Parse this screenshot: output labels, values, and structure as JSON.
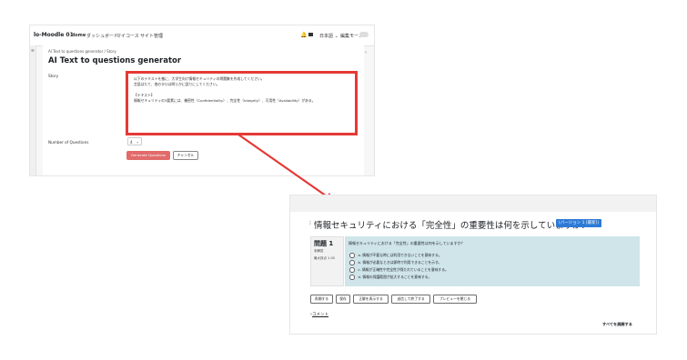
{
  "colors": {
    "highlight": "#e53935",
    "primary_button": "#e26a6a",
    "version_badge": "#2d7ad6",
    "question_panel": "#cfe5ea"
  },
  "screen1": {
    "brand": "lo-Moodle 01",
    "nav_items": [
      "Home",
      "ダッシュボード",
      "マイコース",
      "サイト管理"
    ],
    "lang": "日本語 ⌄",
    "edit_mode": "編集モード",
    "breadcrumb": "AI Text to questions generator  /  Story",
    "title": "AI Text to questions generator",
    "story_label": "Story",
    "story_lines": [
      "以下のテキストを基に、大学生向け情報セキュリティの問題集を作成してください。",
      "言語はたて、他のタロは明らかに誤りにしてください。",
      "",
      "【テキスト】",
      "情報セキュリティの3要素には、機密性（Confidentiality）、完全性（Integrity）、可用性（Availability）がある。"
    ],
    "num_questions_label": "Number of Questions",
    "num_questions_value": "4",
    "generate_button": "Generate Questions",
    "cancel_button": "キャンセル"
  },
  "screen2": {
    "question_title": "情報セキュリティにおける「完全性」の重要性は何を示していますか？",
    "version_badge": "(バージョン 1 [最新])",
    "question_label": "問題 1",
    "state": "未解答",
    "mark": "最大評点 1.00",
    "question_text": "情報セキュリティにおける「完全性」の重要性は何を示していますか？",
    "options": [
      "a.  情報が不要な時には利用できないことを意味する。",
      "b.  情報が必要なときは即時で利用できることを示す。",
      "c.  情報が正確性や完全性が保たれていることを意味する。",
      "d.  情報の保護範囲が拡大することを意味する。"
    ],
    "buttons": [
      "再開する",
      "保存",
      "正解を表示する",
      "送信して終了する",
      "プレビューを閉じる"
    ],
    "comment_link": "コメント",
    "show_all": "すべてを展開する"
  }
}
